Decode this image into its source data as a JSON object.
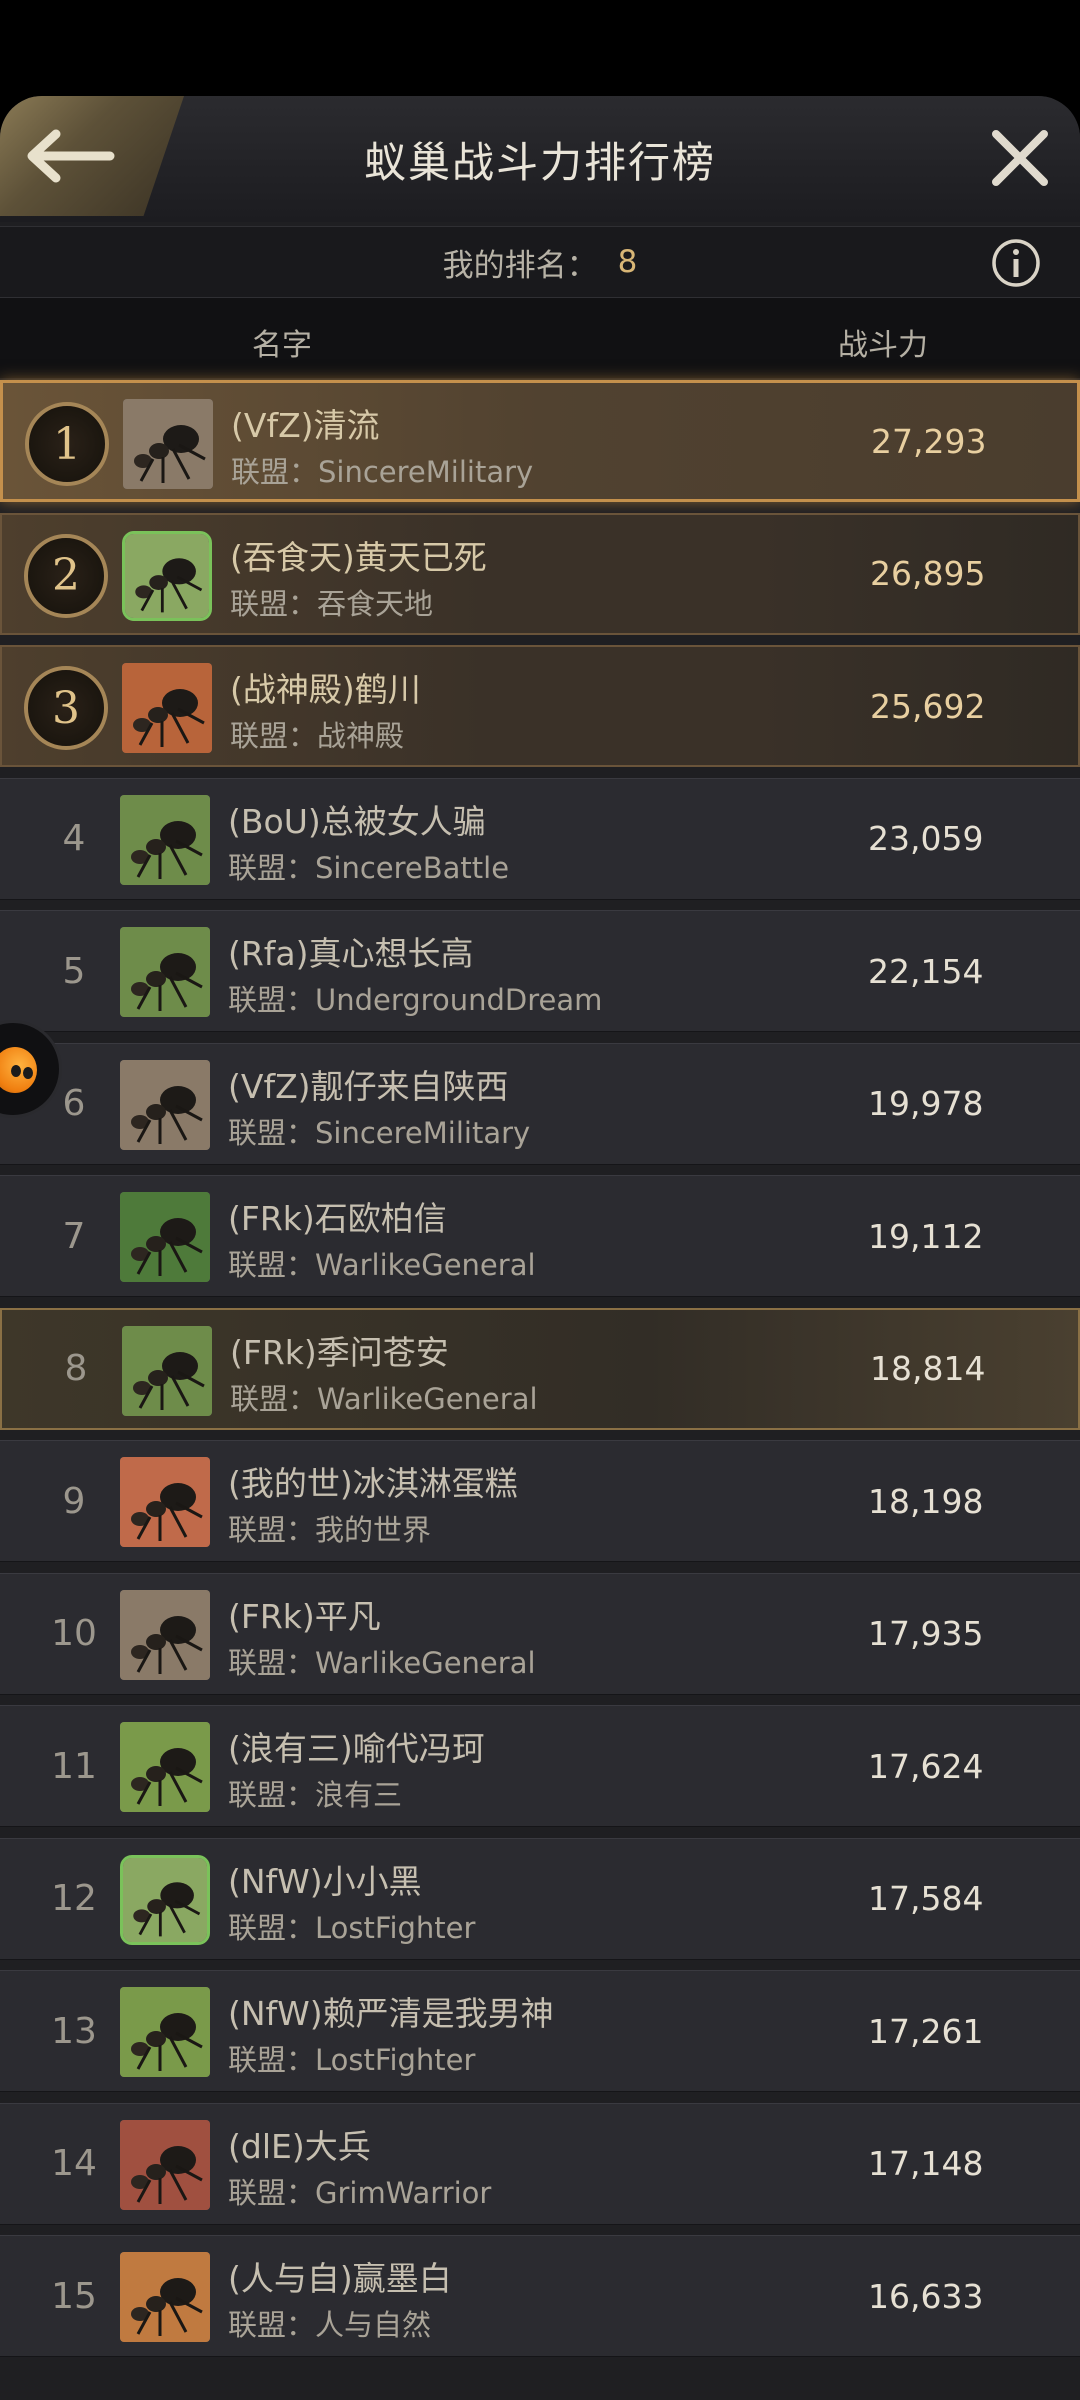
{
  "header": {
    "title": "蚁巢战斗力排行榜",
    "back_icon": "arrow-left-icon",
    "close_icon": "close-icon"
  },
  "rank_bar": {
    "label": "我的排名：",
    "value": "8",
    "info_icon": "info-icon"
  },
  "columns": {
    "name": "名字",
    "power": "战斗力"
  },
  "rows": [
    {
      "rank": "1",
      "name": "(VfZ)清流",
      "alliance": "联盟：SincereMilitary",
      "power": "27,293",
      "avatar": "#8a7a68"
    },
    {
      "rank": "2",
      "name": "(吞食天)黄天已死",
      "alliance": "联盟：吞食天地",
      "power": "26,895",
      "avatar": "#8aa862"
    },
    {
      "rank": "3",
      "name": "(战神殿)鹤川",
      "alliance": "联盟：战神殿",
      "power": "25,692",
      "avatar": "#b8643a"
    },
    {
      "rank": "4",
      "name": "(BoU)总被女人骗",
      "alliance": "联盟：SincereBattle",
      "power": "23,059",
      "avatar": "#6e8c4a"
    },
    {
      "rank": "5",
      "name": "(Rfa)真心想长高",
      "alliance": "联盟：UndergroundDream",
      "power": "22,154",
      "avatar": "#6e8c4a"
    },
    {
      "rank": "6",
      "name": "(VfZ)靓仔来自陕西",
      "alliance": "联盟：SincereMilitary",
      "power": "19,978",
      "avatar": "#8a7a68"
    },
    {
      "rank": "7",
      "name": "(FRk)石欧柏信",
      "alliance": "联盟：WarlikeGeneral",
      "power": "19,112",
      "avatar": "#4e7a3a"
    },
    {
      "rank": "8",
      "name": "(FRk)季问苍安",
      "alliance": "联盟：WarlikeGeneral",
      "power": "18,814",
      "avatar": "#6e8c4a"
    },
    {
      "rank": "9",
      "name": "(我的世)冰淇淋蛋糕",
      "alliance": "联盟：我的世界",
      "power": "18,198",
      "avatar": "#c06a4a"
    },
    {
      "rank": "10",
      "name": "(FRk)平凡",
      "alliance": "联盟：WarlikeGeneral",
      "power": "17,935",
      "avatar": "#8a7a68"
    },
    {
      "rank": "11",
      "name": "(浪有三)喻代冯珂",
      "alliance": "联盟：浪有三",
      "power": "17,624",
      "avatar": "#7a9a4a"
    },
    {
      "rank": "12",
      "name": "(NfW)小小黑",
      "alliance": "联盟：LostFighter",
      "power": "17,584",
      "avatar": "#8aa862"
    },
    {
      "rank": "13",
      "name": "(NfW)赖严清是我男神",
      "alliance": "联盟：LostFighter",
      "power": "17,261",
      "avatar": "#7a9a4a"
    },
    {
      "rank": "14",
      "name": "(dlE)大兵",
      "alliance": "联盟：GrimWarrior",
      "power": "17,148",
      "avatar": "#a05040"
    },
    {
      "rank": "15",
      "name": "(人与自)赢墨白",
      "alliance": "联盟：人与自然",
      "power": "16,633",
      "avatar": "#c07a40"
    }
  ],
  "colors": {
    "gold": "#d8b676",
    "first_border": "#c4904c"
  }
}
